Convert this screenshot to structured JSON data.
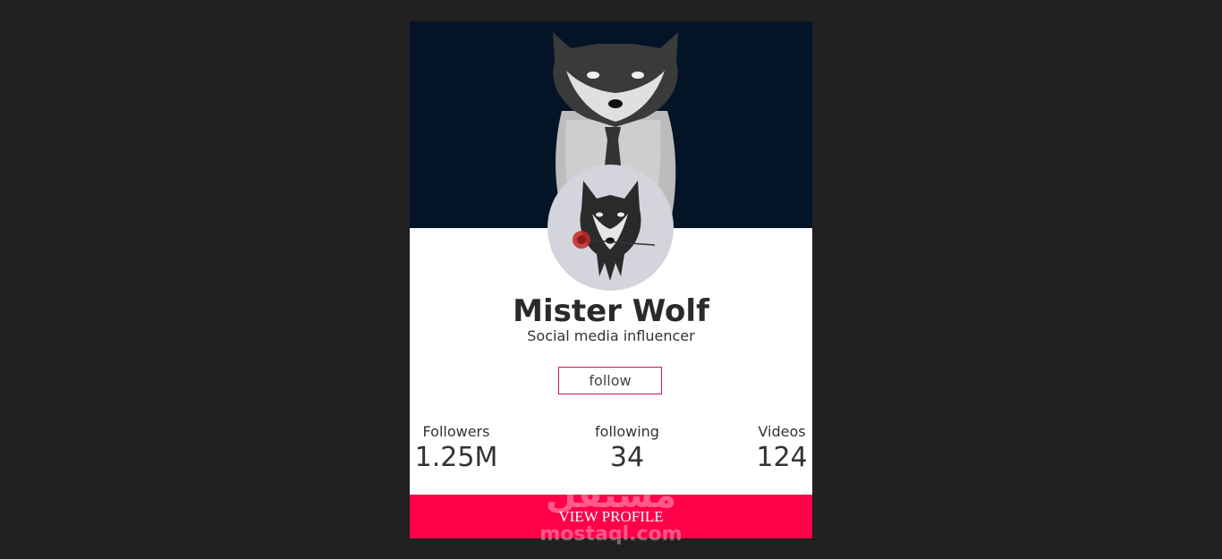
{
  "profile": {
    "name": "Mister Wolf",
    "role": "Social media influencer",
    "follow_label": "follow"
  },
  "stats": {
    "followers": {
      "label": "Followers",
      "value": "1.25M"
    },
    "following": {
      "label": "following",
      "value": "34"
    },
    "videos": {
      "label": "Videos",
      "value": "124"
    }
  },
  "actions": {
    "view_profile_label": "VIEW PROFILE"
  },
  "watermark": {
    "arabic": "مستقل",
    "latin": "mostaql.com"
  },
  "colors": {
    "page_bg": "#212121",
    "cover_bg": "#031426",
    "accent": "#ff0049",
    "follow_border": "#c2185b"
  }
}
